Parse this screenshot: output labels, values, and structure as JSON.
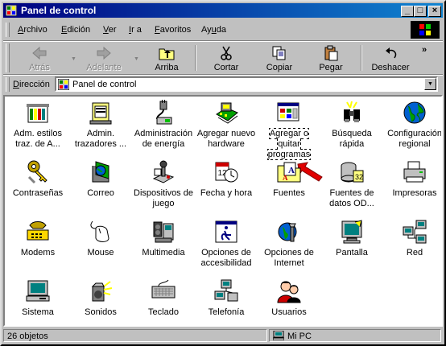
{
  "window": {
    "title": "Panel de control"
  },
  "menu": [
    {
      "pre": "",
      "ul": "A",
      "post": "rchivo"
    },
    {
      "pre": "",
      "ul": "E",
      "post": "dición"
    },
    {
      "pre": "",
      "ul": "V",
      "post": "er"
    },
    {
      "pre": "",
      "ul": "I",
      "post": "r a"
    },
    {
      "pre": "",
      "ul": "F",
      "post": "avoritos"
    },
    {
      "pre": "Ay",
      "ul": "u",
      "post": "da"
    }
  ],
  "toolbar": {
    "back": "Atrás",
    "forward": "Adelante",
    "up": "Arriba",
    "cut": "Cortar",
    "copy": "Copiar",
    "paste": "Pegar",
    "undo": "Deshacer",
    "more": "»"
  },
  "address": {
    "label_ul": "D",
    "label_rest": "irección",
    "value": "Panel de control"
  },
  "items": [
    {
      "name": "item-adm-estilos",
      "label": "Adm. estilos traz. de A...",
      "icon": "fonts-styles-icon"
    },
    {
      "name": "item-admin-trazadores",
      "label": "Admin. trazadores ...",
      "icon": "plotter-manager-icon"
    },
    {
      "name": "item-admin-energia",
      "label": "Administración de energía",
      "icon": "power-management-icon"
    },
    {
      "name": "item-agregar-hardware",
      "label": "Agregar nuevo hardware",
      "icon": "add-hardware-icon"
    },
    {
      "name": "item-agregar-quitar",
      "label": "Agregar o quitar programas",
      "icon": "add-remove-programs-icon",
      "selected": true
    },
    {
      "name": "item-busqueda-rapida",
      "label": "Búsqueda rápida",
      "icon": "binoculars-icon"
    },
    {
      "name": "item-config-regional",
      "label": "Configuración regional",
      "icon": "globe-icon"
    },
    {
      "name": "item-contrasenas",
      "label": "Contraseñas",
      "icon": "keys-icon"
    },
    {
      "name": "item-correo",
      "label": "Correo",
      "icon": "mail-icon"
    },
    {
      "name": "item-dispositivos-juego",
      "label": "Dispositivos de juego",
      "icon": "joystick-icon"
    },
    {
      "name": "item-fecha-hora",
      "label": "Fecha y hora",
      "icon": "calendar-clock-icon"
    },
    {
      "name": "item-fuentes",
      "label": "Fuentes",
      "icon": "fonts-folder-icon"
    },
    {
      "name": "item-fuentes-datos",
      "label": "Fuentes de datos OD...",
      "icon": "odbc-icon"
    },
    {
      "name": "item-impresoras",
      "label": "Impresoras",
      "icon": "printer-icon"
    },
    {
      "name": "item-modems",
      "label": "Modems",
      "icon": "modem-icon"
    },
    {
      "name": "item-mouse",
      "label": "Mouse",
      "icon": "mouse-icon"
    },
    {
      "name": "item-multimedia",
      "label": "Multimedia",
      "icon": "multimedia-icon"
    },
    {
      "name": "item-opciones-accesibilidad",
      "label": "Opciones de accesibilidad",
      "icon": "accessibility-icon"
    },
    {
      "name": "item-opciones-internet",
      "label": "Opciones de Internet",
      "icon": "internet-options-icon"
    },
    {
      "name": "item-pantalla",
      "label": "Pantalla",
      "icon": "display-icon"
    },
    {
      "name": "item-red",
      "label": "Red",
      "icon": "network-icon"
    },
    {
      "name": "item-sistema",
      "label": "Sistema",
      "icon": "system-computer-icon"
    },
    {
      "name": "item-sonidos",
      "label": "Sonidos",
      "icon": "speaker-icon"
    },
    {
      "name": "item-teclado",
      "label": "Teclado",
      "icon": "keyboard-icon"
    },
    {
      "name": "item-telefonia",
      "label": "Telefonía",
      "icon": "telephony-icon"
    },
    {
      "name": "item-usuarios",
      "label": "Usuarios",
      "icon": "users-icon"
    }
  ],
  "status": {
    "count": "26 objetos",
    "zone": "Mi PC"
  }
}
